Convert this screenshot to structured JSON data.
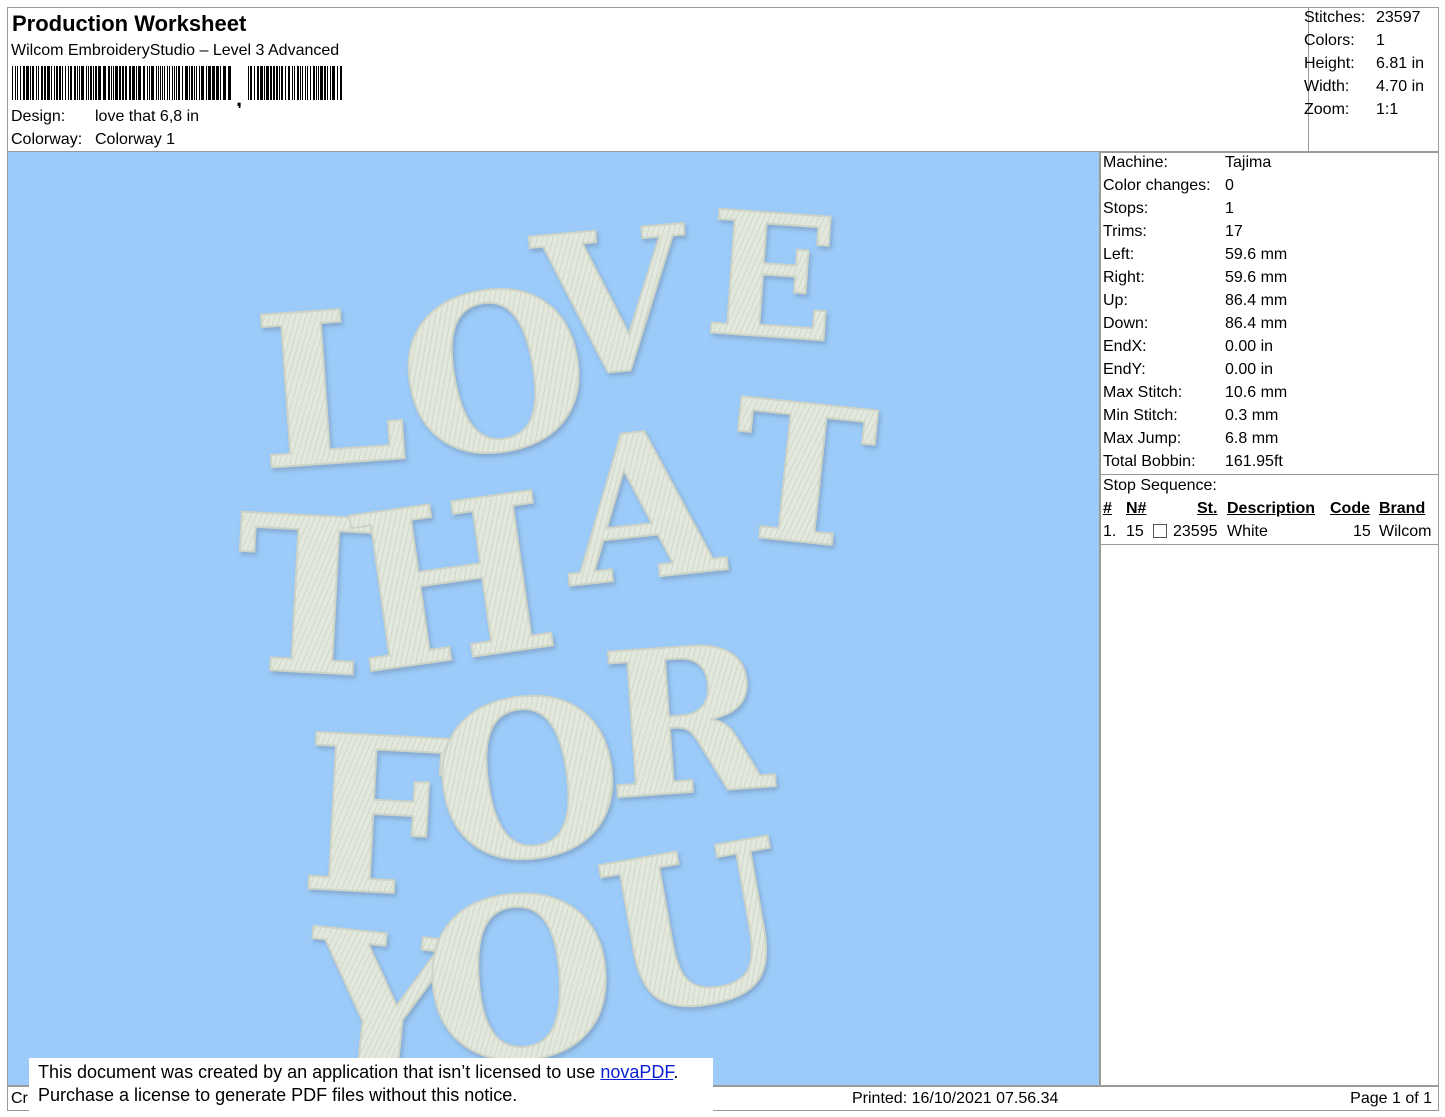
{
  "header": {
    "title": "Production Worksheet",
    "subtitle": "Wilcom EmbroideryStudio – Level 3 Advanced",
    "barcode_separator": ",",
    "design_label": "Design:",
    "design_value": "love that 6,8 in",
    "colorway_label": "Colorway:",
    "colorway_value": "Colorway 1"
  },
  "top_stats": [
    {
      "label": "Stitches:",
      "value": "23597"
    },
    {
      "label": "Colors:",
      "value": "1"
    },
    {
      "label": "Height:",
      "value": "6.81 in"
    },
    {
      "label": "Width:",
      "value": "4.70 in"
    },
    {
      "label": "Zoom:",
      "value": "1:1"
    }
  ],
  "machine_stats": [
    {
      "label": "Machine:",
      "value": "Tajima"
    },
    {
      "label": "Color changes:",
      "value": "0"
    },
    {
      "label": "Stops:",
      "value": "1"
    },
    {
      "label": "Trims:",
      "value": "17"
    },
    {
      "label": "Left:",
      "value": "59.6 mm"
    },
    {
      "label": "Right:",
      "value": "59.6 mm"
    },
    {
      "label": "Up:",
      "value": "86.4 mm"
    },
    {
      "label": "Down:",
      "value": "86.4 mm"
    },
    {
      "label": "EndX:",
      "value": "0.00 in"
    },
    {
      "label": "EndY:",
      "value": "0.00 in"
    },
    {
      "label": "Max Stitch:",
      "value": "10.6 mm"
    },
    {
      "label": "Min Stitch:",
      "value": "0.3 mm"
    },
    {
      "label": "Max Jump:",
      "value": "6.8 mm"
    },
    {
      "label": "Total Bobbin:",
      "value": "161.95ft"
    }
  ],
  "stop_sequence": {
    "title": "Stop Sequence:",
    "columns": {
      "index": "#",
      "needle": "N#",
      "stitches": "St.",
      "description": "Description",
      "code": "Code",
      "brand": "Brand"
    },
    "rows": [
      {
        "index": "1.",
        "needle": "15",
        "swatch_color": "#ffffff",
        "stitches": "23595",
        "description": "White",
        "code": "15",
        "brand": "Wilcom"
      }
    ]
  },
  "design": {
    "background_color": "#9ccbf9",
    "thread_color": "#e3e8dc",
    "lines": [
      "LOVE",
      "THAT",
      "FOR",
      "YOU"
    ]
  },
  "footer": {
    "left_text": "Cr",
    "printed": "Printed: 16/10/2021 07.56.34",
    "page": "Page 1 of 1"
  },
  "notice": {
    "line1_prefix": "This document was created by an application that isn’t licensed to use ",
    "link_text": "novaPDF",
    "line1_suffix": ".",
    "line2": "Purchase a license to generate PDF files without this notice."
  }
}
